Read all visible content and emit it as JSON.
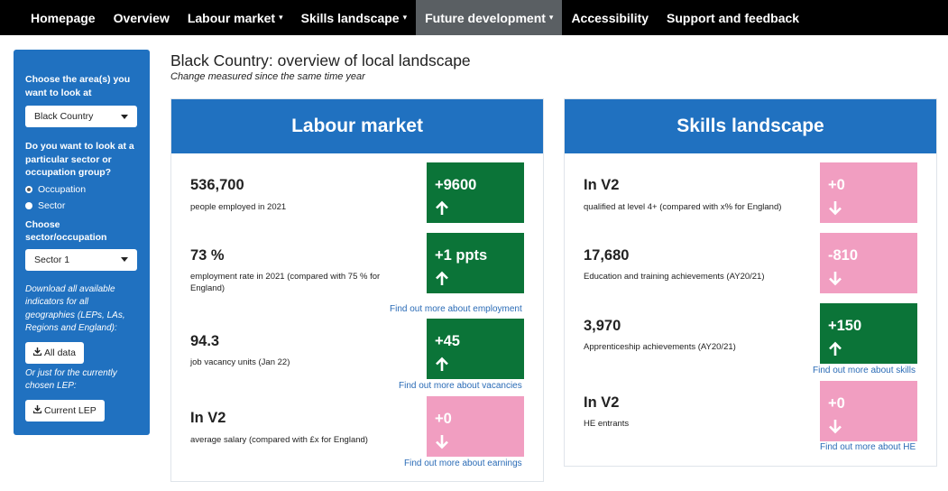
{
  "nav": {
    "items": [
      {
        "label": "Homepage",
        "caret": false,
        "active": false
      },
      {
        "label": "Overview",
        "caret": false,
        "active": false
      },
      {
        "label": "Labour market",
        "caret": true,
        "active": false
      },
      {
        "label": "Skills landscape",
        "caret": true,
        "active": false
      },
      {
        "label": "Future development",
        "caret": true,
        "active": true
      },
      {
        "label": "Accessibility",
        "caret": false,
        "active": false
      },
      {
        "label": "Support and feedback",
        "caret": false,
        "active": false
      }
    ]
  },
  "sidebar": {
    "area_label": "Choose the area(s) you want to look at",
    "area_value": "Black Country",
    "group_question": "Do you want to look at a particular sector or occupation group?",
    "radio_occupation": "Occupation",
    "radio_sector": "Sector",
    "selected_radio": "Occupation",
    "sector_label": "Choose sector/occupation",
    "sector_value": "Sector 1",
    "download_note": "Download all available indicators for all geographies (LEPs, LAs, Regions and England):",
    "all_data_button": "All data",
    "current_note": "Or just for the currently chosen LEP:",
    "current_lep_button": "Current LEP"
  },
  "header": {
    "title": "Black Country: overview of local landscape",
    "subtitle": "Change measured since the same time year"
  },
  "labour_market": {
    "title": "Labour market",
    "employed": {
      "stat": "536,700",
      "desc": "people employed in 2021",
      "change": "+9600",
      "direction": "up",
      "color": "#0b7438"
    },
    "employment_rate": {
      "stat": "73 %",
      "desc": "employment rate in 2021 (compared with 75 % for England)",
      "change": "+1 ppts",
      "direction": "up",
      "color": "#0b7438"
    },
    "employment_link": "Find out more about employment",
    "vacancies": {
      "stat": "94.3",
      "desc": "job vacancy units (Jan 22)",
      "change": "+45",
      "direction": "up",
      "color": "#0b7438"
    },
    "vacancies_link": "Find out more about vacancies",
    "salary": {
      "stat": "In V2",
      "desc": "average salary (compared with £x for England)",
      "change": "+0",
      "direction": "down",
      "color": "#f19ec1"
    },
    "earnings_link": "Find out more about earnings"
  },
  "skills": {
    "title": "Skills landscape",
    "level4": {
      "stat": "In V2",
      "desc": "qualified at level 4+ (compared with x% for England)",
      "change": "+0",
      "direction": "down",
      "color": "#f19ec1"
    },
    "education": {
      "stat": "17,680",
      "desc": "Education and training achievements (AY20/21)",
      "change": "-810",
      "direction": "down",
      "color": "#f19ec1"
    },
    "apprenticeship": {
      "stat": "3,970",
      "desc": "Apprenticeship achievements (AY20/21)",
      "change": "+150",
      "direction": "up",
      "color": "#0b7438"
    },
    "skills_link": "Find out more about skills",
    "he": {
      "stat": "In V2",
      "desc": "HE entrants",
      "change": "+0",
      "direction": "down",
      "color": "#f19ec1"
    },
    "he_link": "Find out more about HE"
  }
}
